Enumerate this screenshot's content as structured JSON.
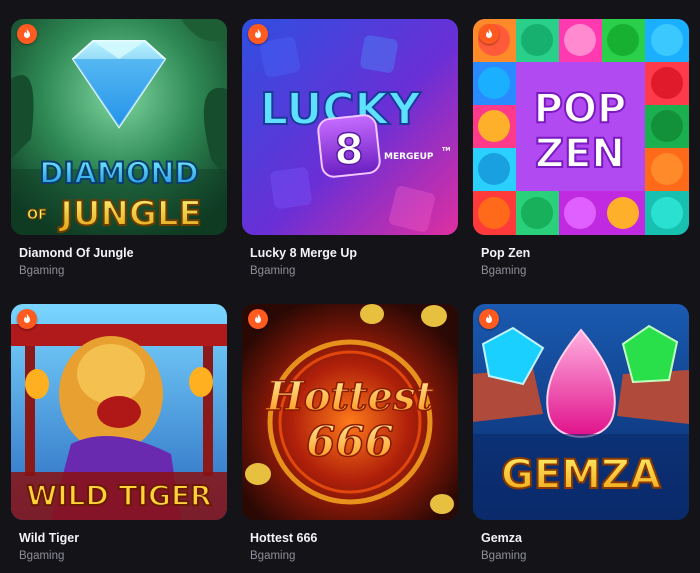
{
  "games": [
    {
      "title": "Diamond Of Jungle",
      "provider": "Bgaming",
      "logo_line1": "DIAMOND",
      "logo_line2a": "OF",
      "logo_line2b": "JUNGLE",
      "badge_icon": "flame-icon"
    },
    {
      "title": "Lucky 8 Merge Up",
      "provider": "Bgaming",
      "logo_word": "LUCKY",
      "logo_number": "8",
      "logo_sub": "MERGEUP",
      "logo_tm": "TM",
      "badge_icon": "flame-icon"
    },
    {
      "title": "Pop Zen",
      "provider": "Bgaming",
      "logo_line1": "POP",
      "logo_line2": "ZEN",
      "badge_icon": "flame-icon"
    },
    {
      "title": "Wild Tiger",
      "provider": "Bgaming",
      "logo_text": "WILD TIGER",
      "badge_icon": "flame-icon"
    },
    {
      "title": "Hottest 666",
      "provider": "Bgaming",
      "logo_line1": "Hottest",
      "logo_line2": "666",
      "badge_icon": "flame-icon"
    },
    {
      "title": "Gemza",
      "provider": "Bgaming",
      "logo_text": "GEMZA",
      "badge_icon": "flame-icon"
    }
  ],
  "colors": {
    "background": "#141418",
    "badge": "#ff5a1f",
    "title": "#f4f4f6",
    "provider": "#8e8e99"
  }
}
